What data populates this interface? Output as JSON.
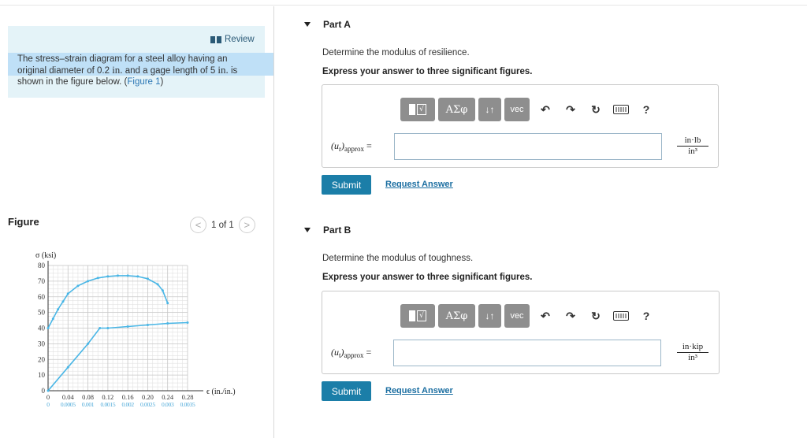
{
  "left": {
    "review_label": "Review",
    "problem_text_a": "The stress–strain diagram for a steel alloy having an original diameter of 0.2 ",
    "unit_in": "in.",
    "problem_text_b": " and a gage length of 5 ",
    "problem_text_c": " is shown in the figure below. (",
    "figure_link": "Figure 1",
    "problem_text_d": ")",
    "figure_heading": "Figure",
    "pager_prev": "<",
    "pager_text": "1 of 1",
    "pager_next": ">"
  },
  "chart_data": {
    "type": "line",
    "ylabel": "σ (ksi)",
    "xlabel": "ϵ (in./in.)",
    "ylim": [
      0,
      80
    ],
    "yticks": [
      "0",
      "10",
      "20",
      "30",
      "40",
      "50",
      "60",
      "70",
      "80"
    ],
    "x_top_ticks": [
      "0",
      "0.04",
      "0.08",
      "0.12",
      "0.16",
      "0.20",
      "0.24",
      "0.28"
    ],
    "x_bottom_ticks": [
      "0",
      "0.0005",
      "0.001",
      "0.0015",
      "0.002",
      "0.0025",
      "0.003",
      "0.0035"
    ],
    "series": [
      {
        "axis": "top",
        "x": [
          0,
          0.01,
          0.02,
          0.03,
          0.04,
          0.06,
          0.08,
          0.1,
          0.12,
          0.14,
          0.16,
          0.18,
          0.2,
          0.22,
          0.23,
          0.24
        ],
        "y": [
          40,
          46,
          52,
          57,
          62,
          67,
          70,
          72,
          73,
          73.5,
          73.5,
          73,
          71.5,
          68,
          64,
          56
        ]
      },
      {
        "axis": "bottom",
        "x": [
          0,
          0.0005,
          0.001,
          0.0013,
          0.0015,
          0.002,
          0.0025,
          0.003,
          0.0035
        ],
        "y": [
          0,
          15,
          30,
          40,
          40,
          41,
          42,
          43,
          43.5
        ]
      }
    ],
    "colors": {
      "curve": "#49b6e6",
      "grid": "#c8c8c8",
      "axis": "#333333"
    }
  },
  "partA": {
    "header": "Part A",
    "prompt": "Determine the modulus of resilience.",
    "instruction": "Express your answer to three significant figures.",
    "label_var": "(u",
    "label_sub_var": "r",
    "label_close": ")",
    "label_sub": "approx",
    "eq": "=",
    "unit_num": "in·lb",
    "unit_den": "in³",
    "input_value": "",
    "submit": "Submit",
    "request": "Request Answer"
  },
  "partB": {
    "header": "Part B",
    "prompt": "Determine the modulus of toughness.",
    "instruction": "Express your answer to three significant figures.",
    "label_var": "(u",
    "label_sub_var": "t",
    "label_close": ")",
    "label_sub": "approx",
    "eq": "=",
    "unit_num": "in·kip",
    "unit_den": "in³",
    "input_value": "",
    "submit": "Submit",
    "request": "Request Answer"
  },
  "toolbar": {
    "templates_glyph": "√",
    "greek": "ΑΣφ",
    "arrows": "↓↑",
    "vec": "vec",
    "undo": "↶",
    "redo": "↷",
    "reset": "↻",
    "help": "?"
  }
}
